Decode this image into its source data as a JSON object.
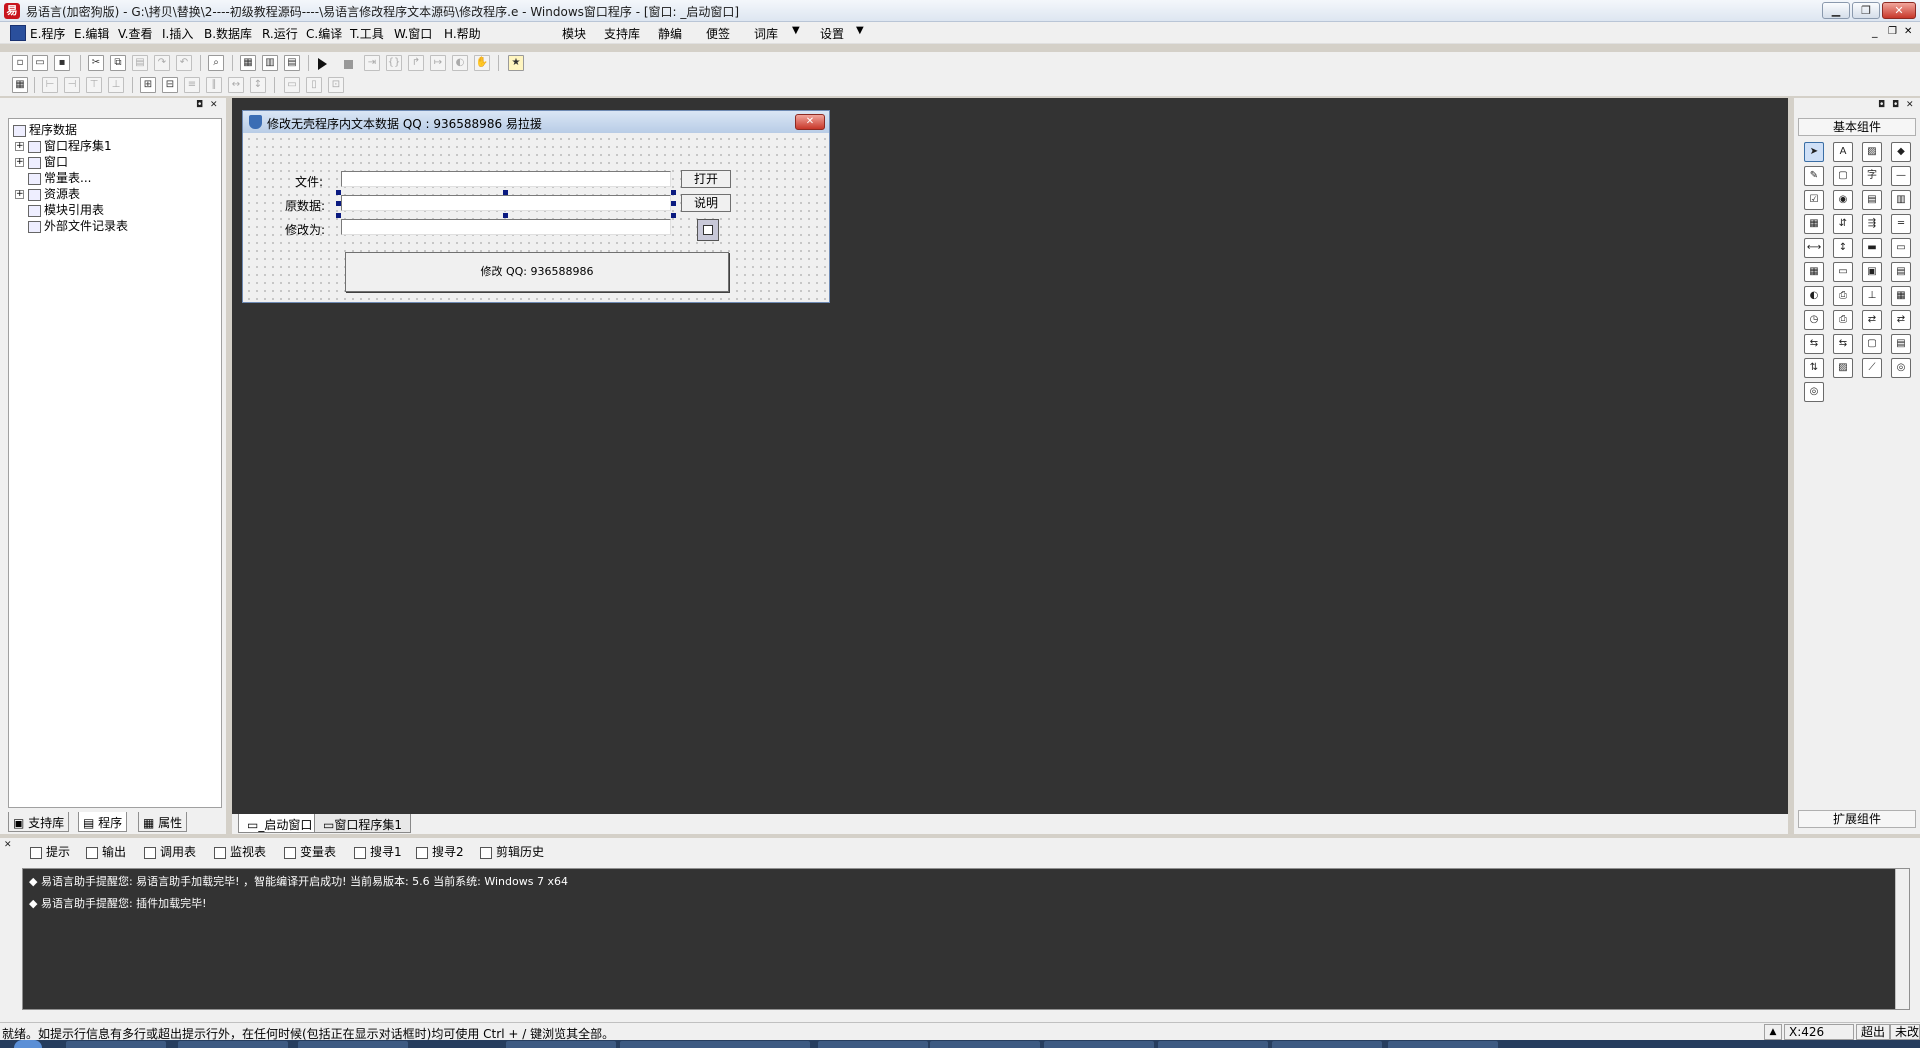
{
  "window": {
    "title": "易语言(加密狗版) - G:\\拷贝\\替换\\2----初级教程源码----\\易语言修改程序文本源码\\修改程序.e - Windows窗口程序 - [窗口: _启动窗口]",
    "app_icon_glyph": "易",
    "controls": {
      "minimize": "▁",
      "restore": "❐",
      "close": "✕"
    },
    "mdi_controls": {
      "minimize": "_",
      "restore": "❐",
      "close": "✕"
    }
  },
  "menu": {
    "items": [
      "E.程序",
      "E.编辑",
      "V.查看",
      "I.插入",
      "B.数据库",
      "R.运行",
      "C.编译",
      "T.工具",
      "W.窗口",
      "H.帮助"
    ],
    "right_items": [
      "模块",
      "支持库",
      "静编",
      "便签",
      "词库",
      "设置"
    ]
  },
  "left_panel": {
    "tree": {
      "root": "程序数据",
      "children": [
        "窗口程序集1",
        "窗口",
        "常量表...",
        "资源表",
        "模块引用表",
        "外部文件记录表"
      ]
    },
    "tabs": [
      "支持库",
      "程序",
      "属性"
    ]
  },
  "form": {
    "title": "修改无壳程序内文本数据 QQ : 936588986  易拉援",
    "close_glyph": "✕",
    "labels": {
      "file": "文件:",
      "original": "原数据:",
      "modify_to": "修改为:"
    },
    "buttons": {
      "open": "打开",
      "explain": "说明",
      "modify": "修改 QQ: 936588986"
    }
  },
  "doc_tabs": [
    "_启动窗口",
    "窗口程序集1"
  ],
  "right_panel": {
    "header": "基本组件",
    "footer": "扩展组件"
  },
  "output": {
    "tabs": [
      "提示",
      "输出",
      "调用表",
      "监视表",
      "变量表",
      "搜寻1",
      "搜寻2",
      "剪辑历史"
    ],
    "lines": [
      "◆ 易语言助手提醒您: 易语言助手加载完毕! ，智能编译开启成功! 当前易版本: 5.6  当前系统: Windows 7 x64",
      "◆ 易语言助手提醒您: 插件加载完毕!"
    ]
  },
  "status": {
    "text": "就绪。如提示行信息有多行或超出提示行外，在任何时候(包括正在显示对话框时)均可使用 Ctrl + / 键浏览其全部。",
    "coord": "X:426",
    "overwrite": "超出",
    "modified": "未改"
  }
}
